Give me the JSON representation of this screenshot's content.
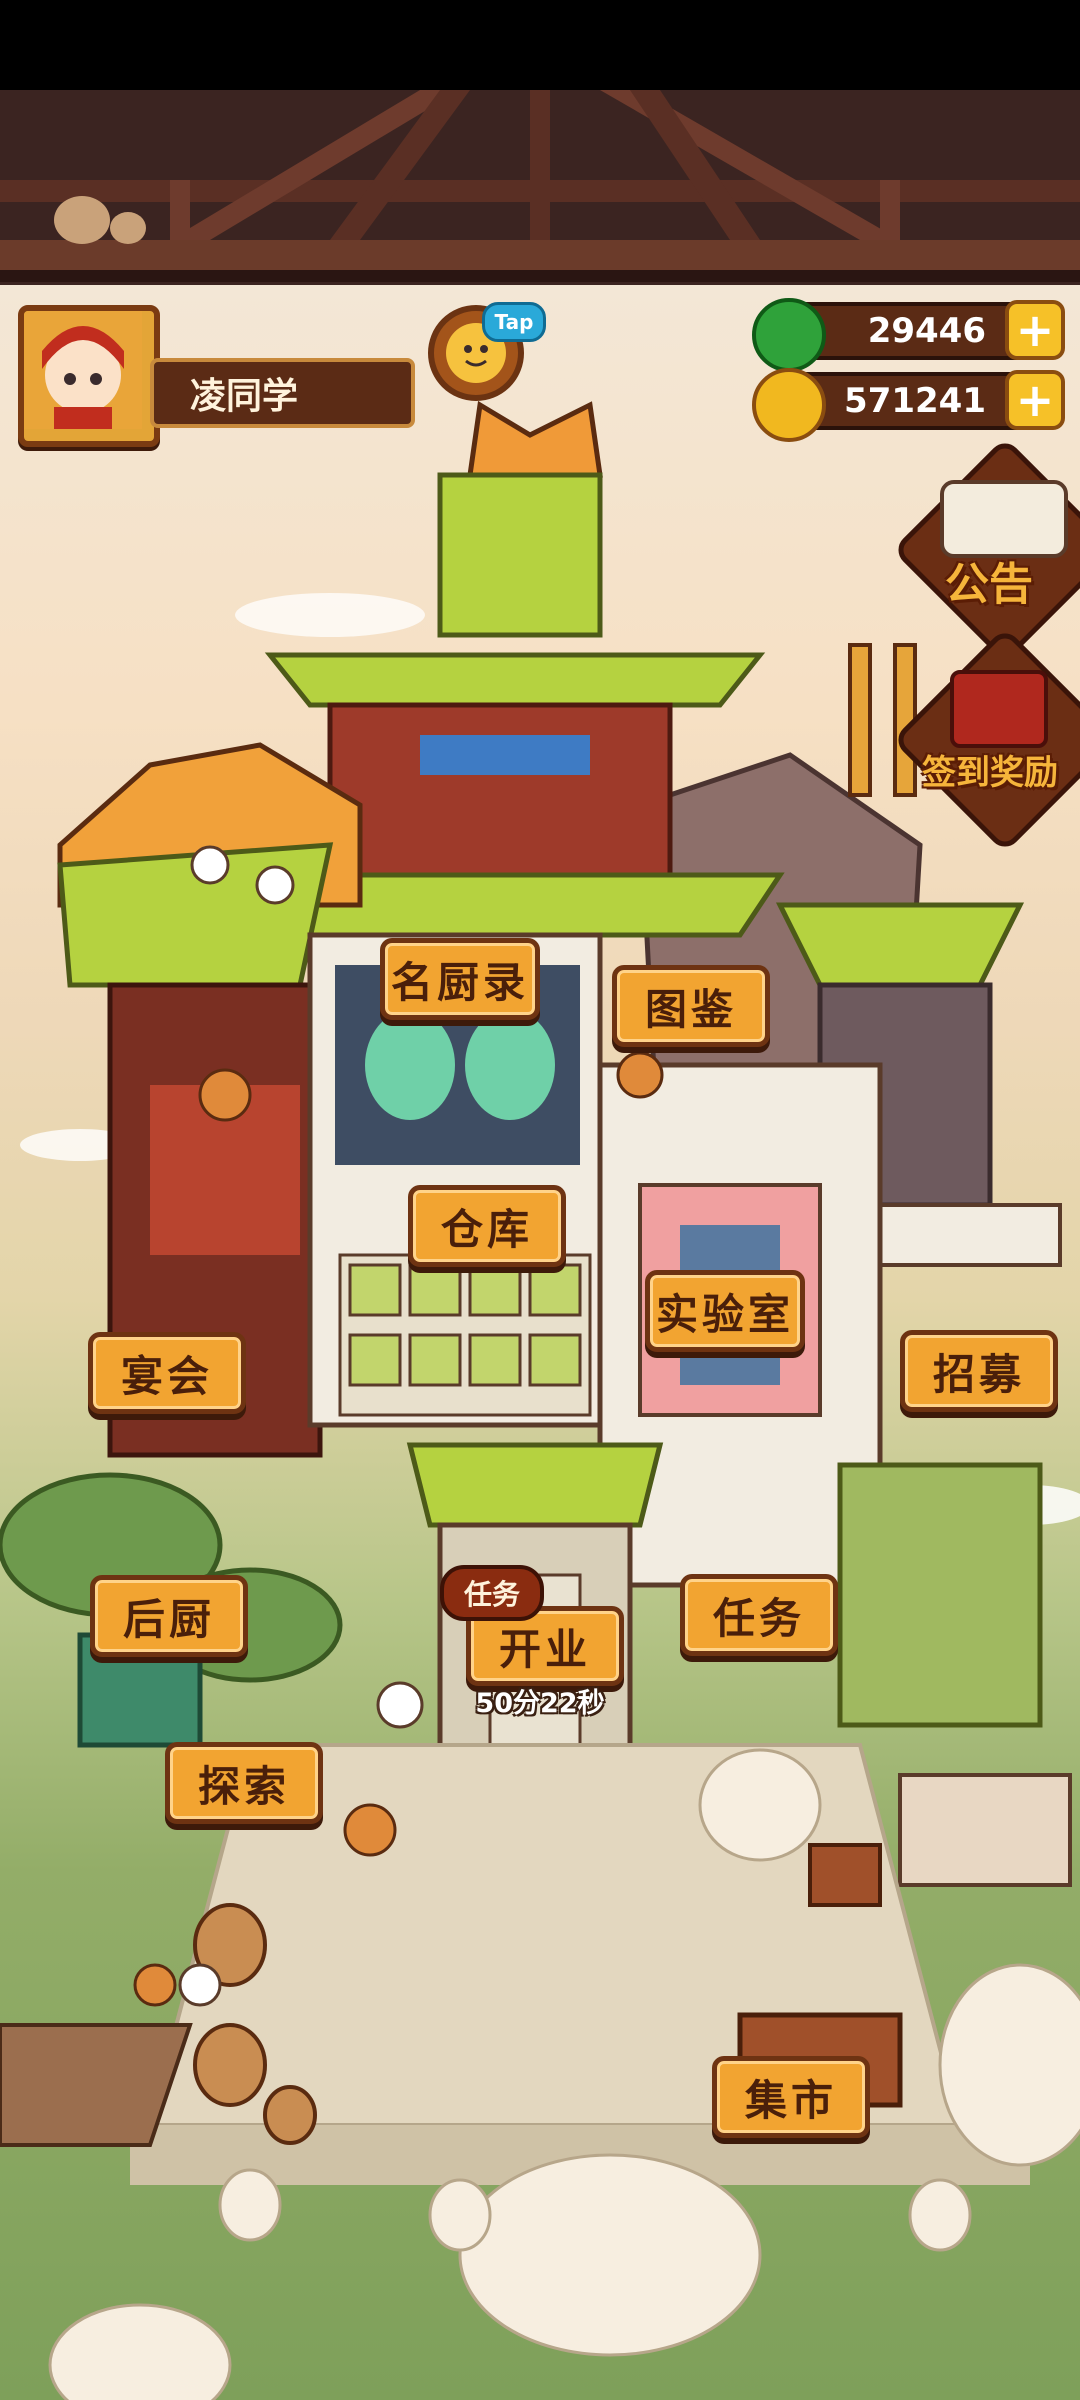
{
  "player": {
    "name": "凌同学"
  },
  "tap": {
    "badge": "Tap"
  },
  "currencies": [
    {
      "name": "jade",
      "value": "29446",
      "icon": "jade-coin-icon",
      "color": "#2fa23a"
    },
    {
      "name": "gold",
      "value": "571241",
      "icon": "gold-coin-icon",
      "color": "#f1b81f"
    }
  ],
  "side_buttons": {
    "announcement": "公告",
    "checkin": "签到奖励"
  },
  "buildings": {
    "famous_chefs": "名厨录",
    "catalog": "图鉴",
    "warehouse": "仓库",
    "lab": "实验室",
    "banquet": "宴会",
    "recruit": "招募",
    "back_kitchen": "后厨",
    "quest": "任务",
    "explore": "探索",
    "market": "集市"
  },
  "open_business": {
    "label": "开业",
    "quest_badge": "任务",
    "timer": "50分22秒"
  },
  "colors": {
    "plank": "#f2a431",
    "plank_border": "#6e3312",
    "roof_green": "#a9c93a",
    "wood_dark": "#3b2421"
  }
}
